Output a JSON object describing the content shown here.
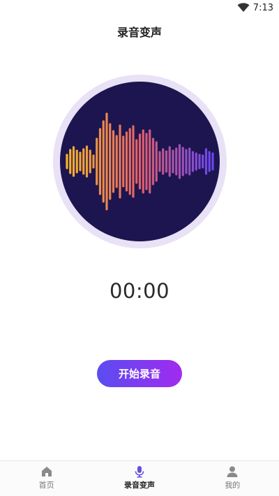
{
  "status_bar": {
    "time": "7:13",
    "wifi_icon": "wifi-icon"
  },
  "header": {
    "title": "录音变声"
  },
  "visualizer": {
    "icon": "waveform-visualizer",
    "colors": {
      "ring": "#e9e1f5",
      "disk": "#1c1550",
      "start": "#f7b52c",
      "mid": "#e1606a",
      "end": "#6a46f0"
    }
  },
  "timer": {
    "value": "00:00"
  },
  "record_button": {
    "label": "开始录音",
    "gradient": [
      "#5a4cf0",
      "#a12bf0"
    ]
  },
  "tabbar": {
    "active_color": "#6a4de0",
    "items": [
      {
        "label": "首页",
        "icon": "home-icon",
        "active": false
      },
      {
        "label": "录音变声",
        "icon": "microphone-icon",
        "active": true
      },
      {
        "label": "我的",
        "icon": "user-icon",
        "active": false
      }
    ]
  }
}
